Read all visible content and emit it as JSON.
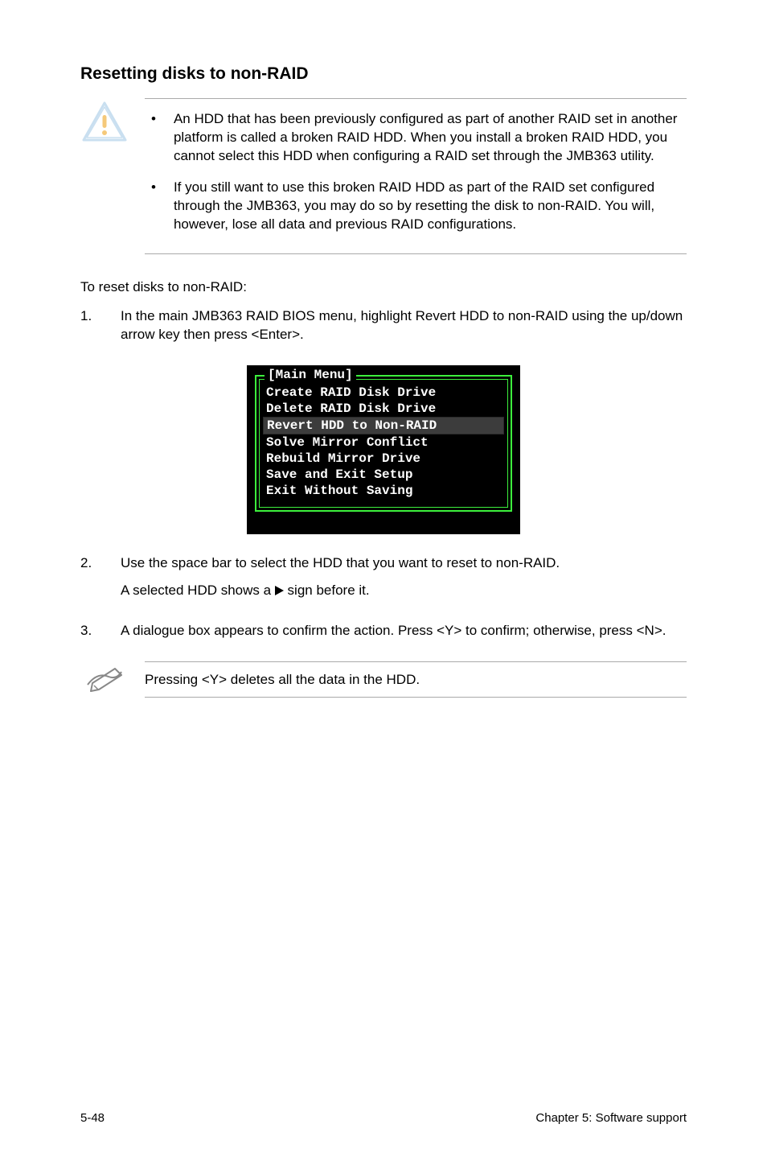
{
  "heading": "Resetting disks to non-RAID",
  "caution": {
    "items": [
      "An HDD that has been previously configured as part of another RAID set in another platform is called a broken RAID HDD. When you install a broken RAID HDD, you cannot select this HDD when configuring a RAID set through the JMB363 utility.",
      "If you still want to use this broken RAID HDD as part of the RAID set configured through the JMB363, you may do so by resetting the disk to non-RAID. You will, however, lose all data and previous RAID configurations."
    ]
  },
  "intro": "To reset disks to non-RAID:",
  "steps": [
    {
      "num": "1.",
      "body": "In the main JMB363 RAID BIOS menu, highlight Revert HDD to non-RAID using the up/down arrow key then press <Enter>."
    },
    {
      "num": "2.",
      "body_line1": "Use the space bar to select the HDD that you want to reset to non-RAID.",
      "body_line2_pre": "A selected HDD shows a ",
      "body_line2_post": " sign before it."
    },
    {
      "num": "3.",
      "body": "A dialogue box appears to confirm the action. Press <Y> to confirm; otherwise, press <N>."
    }
  ],
  "terminal": {
    "title": "[Main Menu]",
    "lines": [
      {
        "text": "Create RAID Disk Drive",
        "hl": false
      },
      {
        "text": "Delete RAID Disk Drive",
        "hl": false
      },
      {
        "text": "Revert HDD to Non-RAID",
        "hl": true
      },
      {
        "text": "Solve Mirror Conflict",
        "hl": false
      },
      {
        "text": "Rebuild Mirror Drive",
        "hl": false
      },
      {
        "text": "Save and Exit Setup",
        "hl": false
      },
      {
        "text": "Exit Without Saving",
        "hl": false
      }
    ]
  },
  "note_text": "Pressing <Y> deletes all the data in the HDD.",
  "footer": {
    "left": "5-48",
    "right": "Chapter 5: Software support"
  }
}
